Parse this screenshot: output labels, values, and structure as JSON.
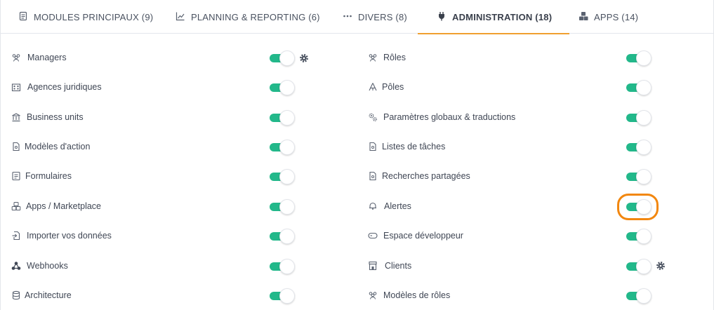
{
  "tabs": [
    {
      "label": "MODULES PRINCIPAUX (9)",
      "icon": "document-icon",
      "active": false
    },
    {
      "label": "PLANNING & REPORTING (6)",
      "icon": "chart-line-icon",
      "active": false
    },
    {
      "label": "DIVERS (8)",
      "icon": "ellipsis-icon",
      "active": false
    },
    {
      "label": "ADMINISTRATION (18)",
      "icon": "plug-icon",
      "active": true
    },
    {
      "label": "APPS (14)",
      "icon": "cubes-icon",
      "active": false
    }
  ],
  "left_column": [
    {
      "label": "Managers",
      "icon": "users-icon",
      "enabled": true,
      "has_settings": true
    },
    {
      "label": "Agences juridiques",
      "icon": "building-icon",
      "enabled": true,
      "has_settings": false
    },
    {
      "label": "Business units",
      "icon": "bank-icon",
      "enabled": true,
      "has_settings": false
    },
    {
      "label": "Modèles d'action",
      "icon": "file-icon",
      "enabled": true,
      "has_settings": false
    },
    {
      "label": "Formulaires",
      "icon": "form-icon",
      "enabled": true,
      "has_settings": false
    },
    {
      "label": "Apps / Marketplace",
      "icon": "cubes-icon",
      "enabled": true,
      "has_settings": false
    },
    {
      "label": "Importer vos données",
      "icon": "file-import-icon",
      "enabled": true,
      "has_settings": false
    },
    {
      "label": "Webhooks",
      "icon": "webhooks-icon",
      "enabled": true,
      "has_settings": false
    },
    {
      "label": "Architecture",
      "icon": "database-icon",
      "enabled": true,
      "has_settings": false
    }
  ],
  "right_column": [
    {
      "label": "Rôles",
      "icon": "users-icon",
      "enabled": true,
      "has_settings": false
    },
    {
      "label": "Pôles",
      "icon": "sitemap-icon",
      "enabled": true,
      "has_settings": false
    },
    {
      "label": "Paramètres globaux & traductions",
      "icon": "cogs-icon",
      "enabled": true,
      "has_settings": false
    },
    {
      "label": "Listes de tâches",
      "icon": "file-icon",
      "enabled": true,
      "has_settings": false
    },
    {
      "label": "Recherches partagées",
      "icon": "file-icon",
      "enabled": true,
      "has_settings": false
    },
    {
      "label": "Alertes",
      "icon": "bell-icon",
      "enabled": true,
      "has_settings": false,
      "highlighted": true
    },
    {
      "label": "Espace développeur",
      "icon": "terminal-icon",
      "enabled": true,
      "has_settings": false
    },
    {
      "label": "Clients",
      "icon": "store-icon",
      "enabled": true,
      "has_settings": true
    },
    {
      "label": "Modèles de rôles",
      "icon": "users-icon",
      "enabled": true,
      "has_settings": false
    }
  ],
  "colors": {
    "toggle_on": "#22b88a",
    "active_tab_underline": "#f0a030",
    "highlight": "#f2870f"
  }
}
